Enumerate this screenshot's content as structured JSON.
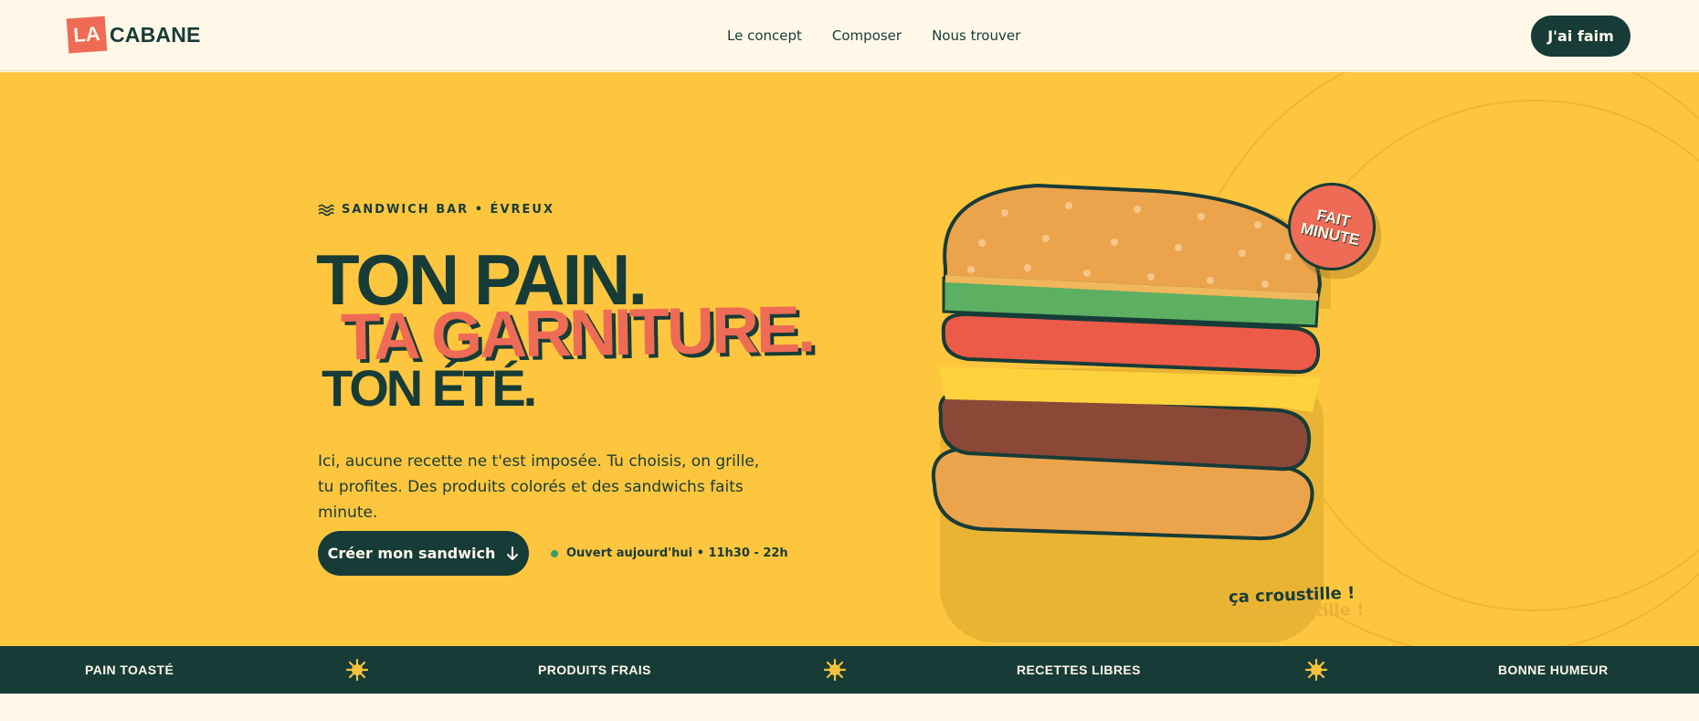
{
  "header": {
    "logo_mark": "LA",
    "logo_text": "CABANE",
    "nav": [
      "Le concept",
      "Composer",
      "Nous trouver"
    ],
    "cta": "J'ai faim"
  },
  "hero": {
    "eyebrow": "SANDWICH BAR • ÉVREUX",
    "title_line1": "TON PAIN.",
    "title_line2": "TA GARNITURE.",
    "title_line3": "TON ÉTÉ.",
    "lead": "Ici, aucune recette ne t'est imposée. Tu choisis, on grille, tu profites. Des produits colorés et des sandwichs faits minute.",
    "button": "Créer mon sandwich",
    "status": "Ouvert aujourd'hui • 11h30 - 22h",
    "badge_line1": "FAIT",
    "badge_line2": "MINUTE",
    "crunch": "ça croustille !"
  },
  "strip": {
    "items": [
      "PAIN TOASTÉ",
      "PRODUITS FRAIS",
      "RECETTES LIBRES",
      "BONNE HUMEUR"
    ],
    "separator_icon": "sun-icon"
  },
  "colors": {
    "background": "#fff7e8",
    "primary": "#173c38",
    "accent": "#ee6b55",
    "hero": "#fec63e"
  }
}
